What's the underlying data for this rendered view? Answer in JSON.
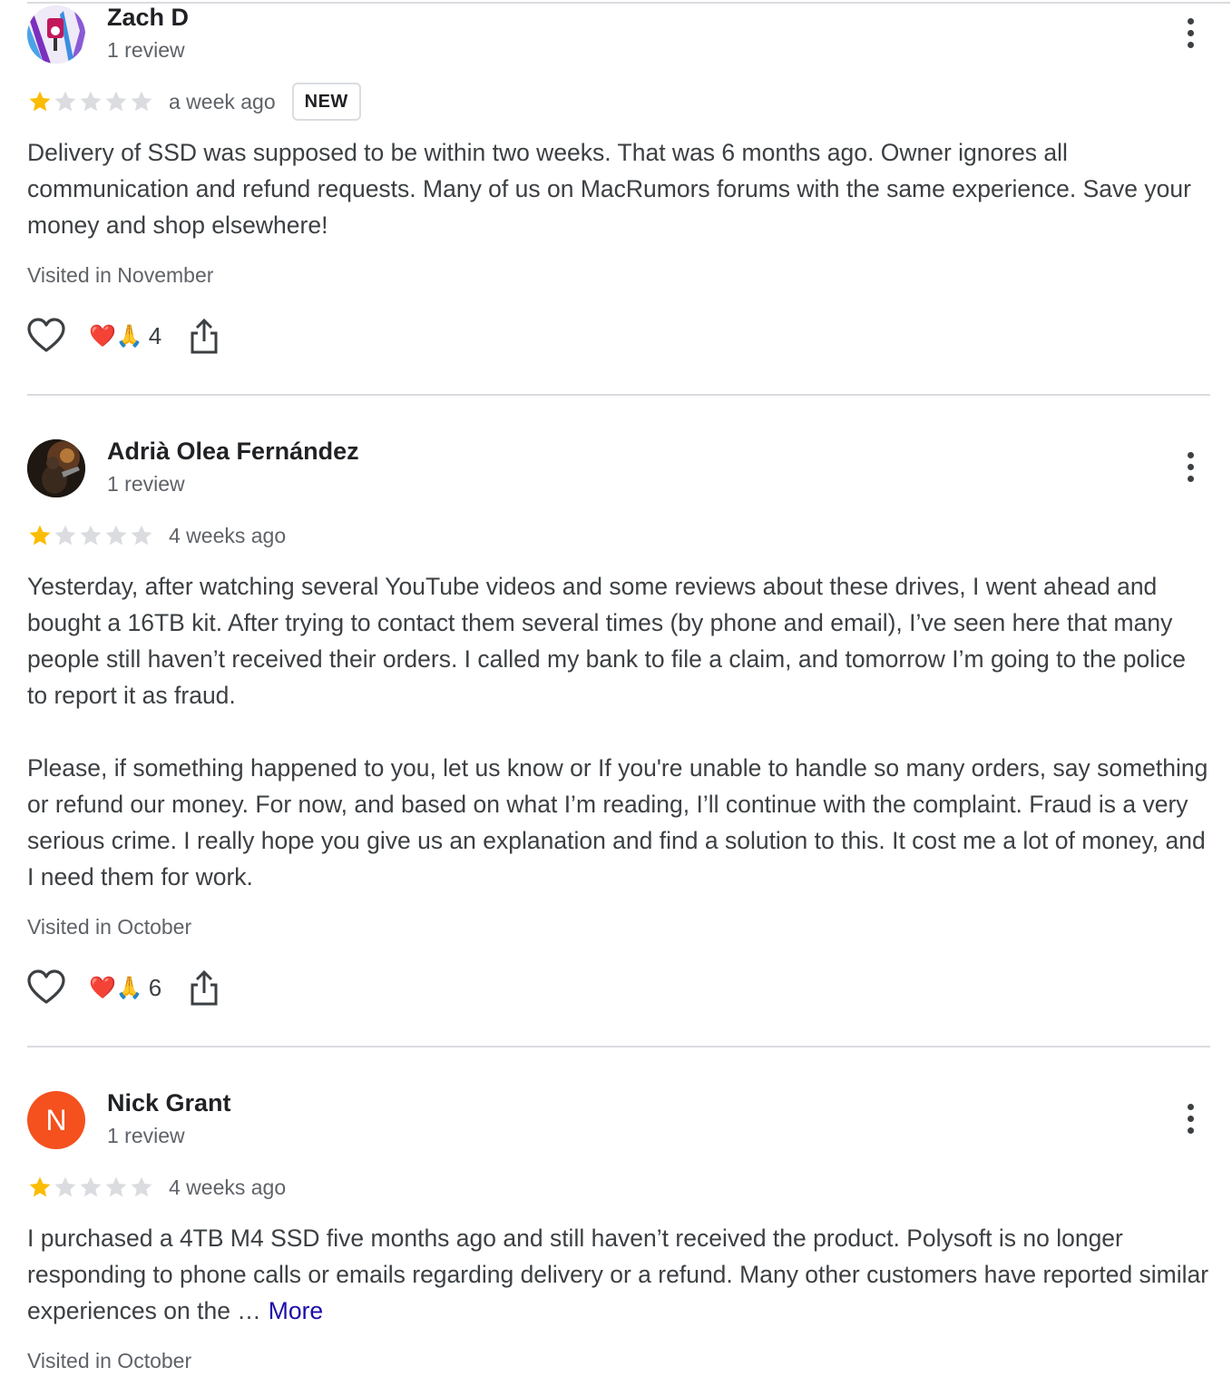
{
  "colors": {
    "star_filled": "#fbbc04",
    "star_empty": "#dadce0",
    "link": "#1a0dab",
    "avatar_letter_bg": "#f4511e"
  },
  "reviews": [
    {
      "name": "Zach D",
      "review_count": "1 review",
      "rating": 1,
      "time": "a week ago",
      "badge": "NEW",
      "paragraphs": [
        "Delivery of SSD was supposed to be within two weeks. That was 6 months ago. Owner ignores all communication and refund requests. Many of us on MacRumors forums with the same experience. Save your money and shop elsewhere!"
      ],
      "visited": "Visited in November",
      "reaction_emoji": "❤️🙏",
      "reaction_count": "4"
    },
    {
      "name": "Adrià Olea Fernández",
      "review_count": "1 review",
      "rating": 1,
      "time": "4 weeks ago",
      "paragraphs": [
        "Yesterday, after watching several YouTube videos and some reviews about these drives, I went ahead and bought a 16TB kit. After trying to contact them several times (by phone and email), I’ve seen here that many people still haven’t received their orders. I called my bank to file a claim, and tomorrow I’m going to the police to report it as fraud.",
        "Please, if something happened to you, let us know or If you're unable to handle so many orders, say something or refund our money. For now, and based on what I’m reading, I’ll continue with the complaint. Fraud is a very serious crime. I really hope you give us an explanation and find a solution to this. It cost me a lot of money, and I need them for work."
      ],
      "visited": "Visited in October",
      "reaction_emoji": "❤️🙏",
      "reaction_count": "6"
    },
    {
      "name": "Nick Grant",
      "avatar_letter": "N",
      "review_count": "1 review",
      "rating": 1,
      "time": "4 weeks ago",
      "paragraphs": [
        "I purchased a 4TB M4 SSD five months ago and still haven’t received the product. Polysoft is no longer responding to phone calls or emails regarding delivery or a refund. Many other customers have reported similar experiences on the …"
      ],
      "more_label": "More",
      "visited": "Visited in October"
    }
  ]
}
